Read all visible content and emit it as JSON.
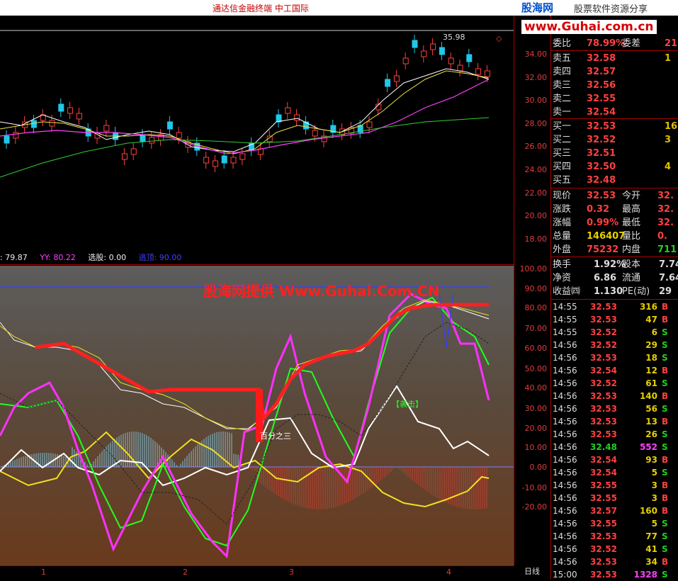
{
  "window": {
    "title": "通达信金融终端    中工国际",
    "logo": "股海网",
    "logo_sub": "股票软件资源分享",
    "url_banner": "www.Guhai.com.cn",
    "close_symbol": "◇"
  },
  "top_chart": {
    "high_label": "35.98",
    "price_axis": [
      "34.00",
      "32.00",
      "30.00",
      "28.00",
      "26.00",
      "24.00",
      "22.00",
      "20.00",
      "18.00"
    ]
  },
  "indicator_bar": {
    "xx": ": 79.87",
    "yy": "YY: 80.22",
    "xuangu": "选股: 0.00",
    "taopao": "逃顶: 90.00"
  },
  "bottom_chart": {
    "watermark": "股海网提供 Www.Guhai.Com.CN",
    "label_baifen": "百分之三",
    "label_luanjia": "【袭击】",
    "axis": [
      "100.00",
      "90.00",
      "80.00",
      "70.00",
      "60.00",
      "50.00",
      "40.00",
      "30.00",
      "20.00",
      "10.00",
      "0.00",
      "-10.00",
      "-20.00"
    ]
  },
  "x_axis": {
    "ticks": [
      "1",
      "2",
      "3",
      "4"
    ],
    "period": "日线"
  },
  "quote_panel": {
    "weibi": {
      "label": "委比",
      "value": "78.99%",
      "label2": "委差",
      "value2": "21"
    },
    "asks": [
      {
        "label": "卖五",
        "price": "32.58",
        "vol": "1"
      },
      {
        "label": "卖四",
        "price": "32.57",
        "vol": ""
      },
      {
        "label": "卖三",
        "price": "32.56",
        "vol": ""
      },
      {
        "label": "卖二",
        "price": "32.55",
        "vol": ""
      },
      {
        "label": "卖一",
        "price": "32.54",
        "vol": ""
      }
    ],
    "bids": [
      {
        "label": "买一",
        "price": "32.53",
        "vol": "16"
      },
      {
        "label": "买二",
        "price": "32.52",
        "vol": "3"
      },
      {
        "label": "买三",
        "price": "32.51",
        "vol": ""
      },
      {
        "label": "买四",
        "price": "32.50",
        "vol": "4"
      },
      {
        "label": "买五",
        "price": "32.48",
        "vol": ""
      }
    ],
    "stats1": [
      {
        "l1": "现价",
        "v1": "32.53",
        "l2": "今开",
        "v2": "32."
      },
      {
        "l1": "涨跌",
        "v1": "0.32",
        "l2": "最高",
        "v2": "32."
      },
      {
        "l1": "涨幅",
        "v1": "0.99%",
        "l2": "最低",
        "v2": "32."
      },
      {
        "l1": "总量",
        "v1": "146407",
        "l2": "量比",
        "v2": "0."
      },
      {
        "l1": "外盘",
        "v1": "75232",
        "l2": "内盘",
        "v2": "711"
      }
    ],
    "stats2": [
      {
        "l1": "换手",
        "v1": "1.92%",
        "l2": "股本",
        "v2": "7.74"
      },
      {
        "l1": "净资",
        "v1": "6.86",
        "l2": "流通",
        "v2": "7.64"
      },
      {
        "l1": "收益㈣",
        "v1": "1.130",
        "l2": "PE(动)",
        "v2": "29"
      }
    ],
    "ticks": [
      {
        "t": "14:55",
        "p": "32.53",
        "v": "316",
        "f": "B"
      },
      {
        "t": "14:55",
        "p": "32.53",
        "v": "47",
        "f": "B"
      },
      {
        "t": "14:55",
        "p": "32.52",
        "v": "6",
        "f": "S"
      },
      {
        "t": "14:56",
        "p": "32.52",
        "v": "29",
        "f": "S"
      },
      {
        "t": "14:56",
        "p": "32.53",
        "v": "18",
        "f": "S"
      },
      {
        "t": "14:56",
        "p": "32.54",
        "v": "12",
        "f": "B"
      },
      {
        "t": "14:56",
        "p": "32.52",
        "v": "61",
        "f": "S"
      },
      {
        "t": "14:56",
        "p": "32.53",
        "v": "140",
        "f": "B"
      },
      {
        "t": "14:56",
        "p": "32.53",
        "v": "56",
        "f": "S"
      },
      {
        "t": "14:56",
        "p": "32.53",
        "v": "13",
        "f": "B"
      },
      {
        "t": "14:56",
        "p": "32.53",
        "v": "26",
        "f": "S"
      },
      {
        "t": "14:56",
        "p": "32.48",
        "v": "552",
        "f": "S"
      },
      {
        "t": "14:56",
        "p": "32.54",
        "v": "93",
        "f": "B"
      },
      {
        "t": "14:56",
        "p": "32.54",
        "v": "5",
        "f": "S"
      },
      {
        "t": "14:56",
        "p": "32.55",
        "v": "3",
        "f": "B"
      },
      {
        "t": "14:56",
        "p": "32.55",
        "v": "3",
        "f": "B"
      },
      {
        "t": "14:56",
        "p": "32.57",
        "v": "160",
        "f": "B"
      },
      {
        "t": "14:56",
        "p": "32.55",
        "v": "5",
        "f": "S"
      },
      {
        "t": "14:56",
        "p": "32.53",
        "v": "77",
        "f": "S"
      },
      {
        "t": "14:56",
        "p": "32.52",
        "v": "41",
        "f": "S"
      },
      {
        "t": "14:56",
        "p": "32.53",
        "v": "34",
        "f": "B"
      },
      {
        "t": "15:00",
        "p": "32.53",
        "v": "1328",
        "f": "S"
      }
    ]
  },
  "colors": {
    "up": "#ff4040",
    "down": "#20c8e8",
    "ask": "#ff4040",
    "bid": "#20d020"
  }
}
